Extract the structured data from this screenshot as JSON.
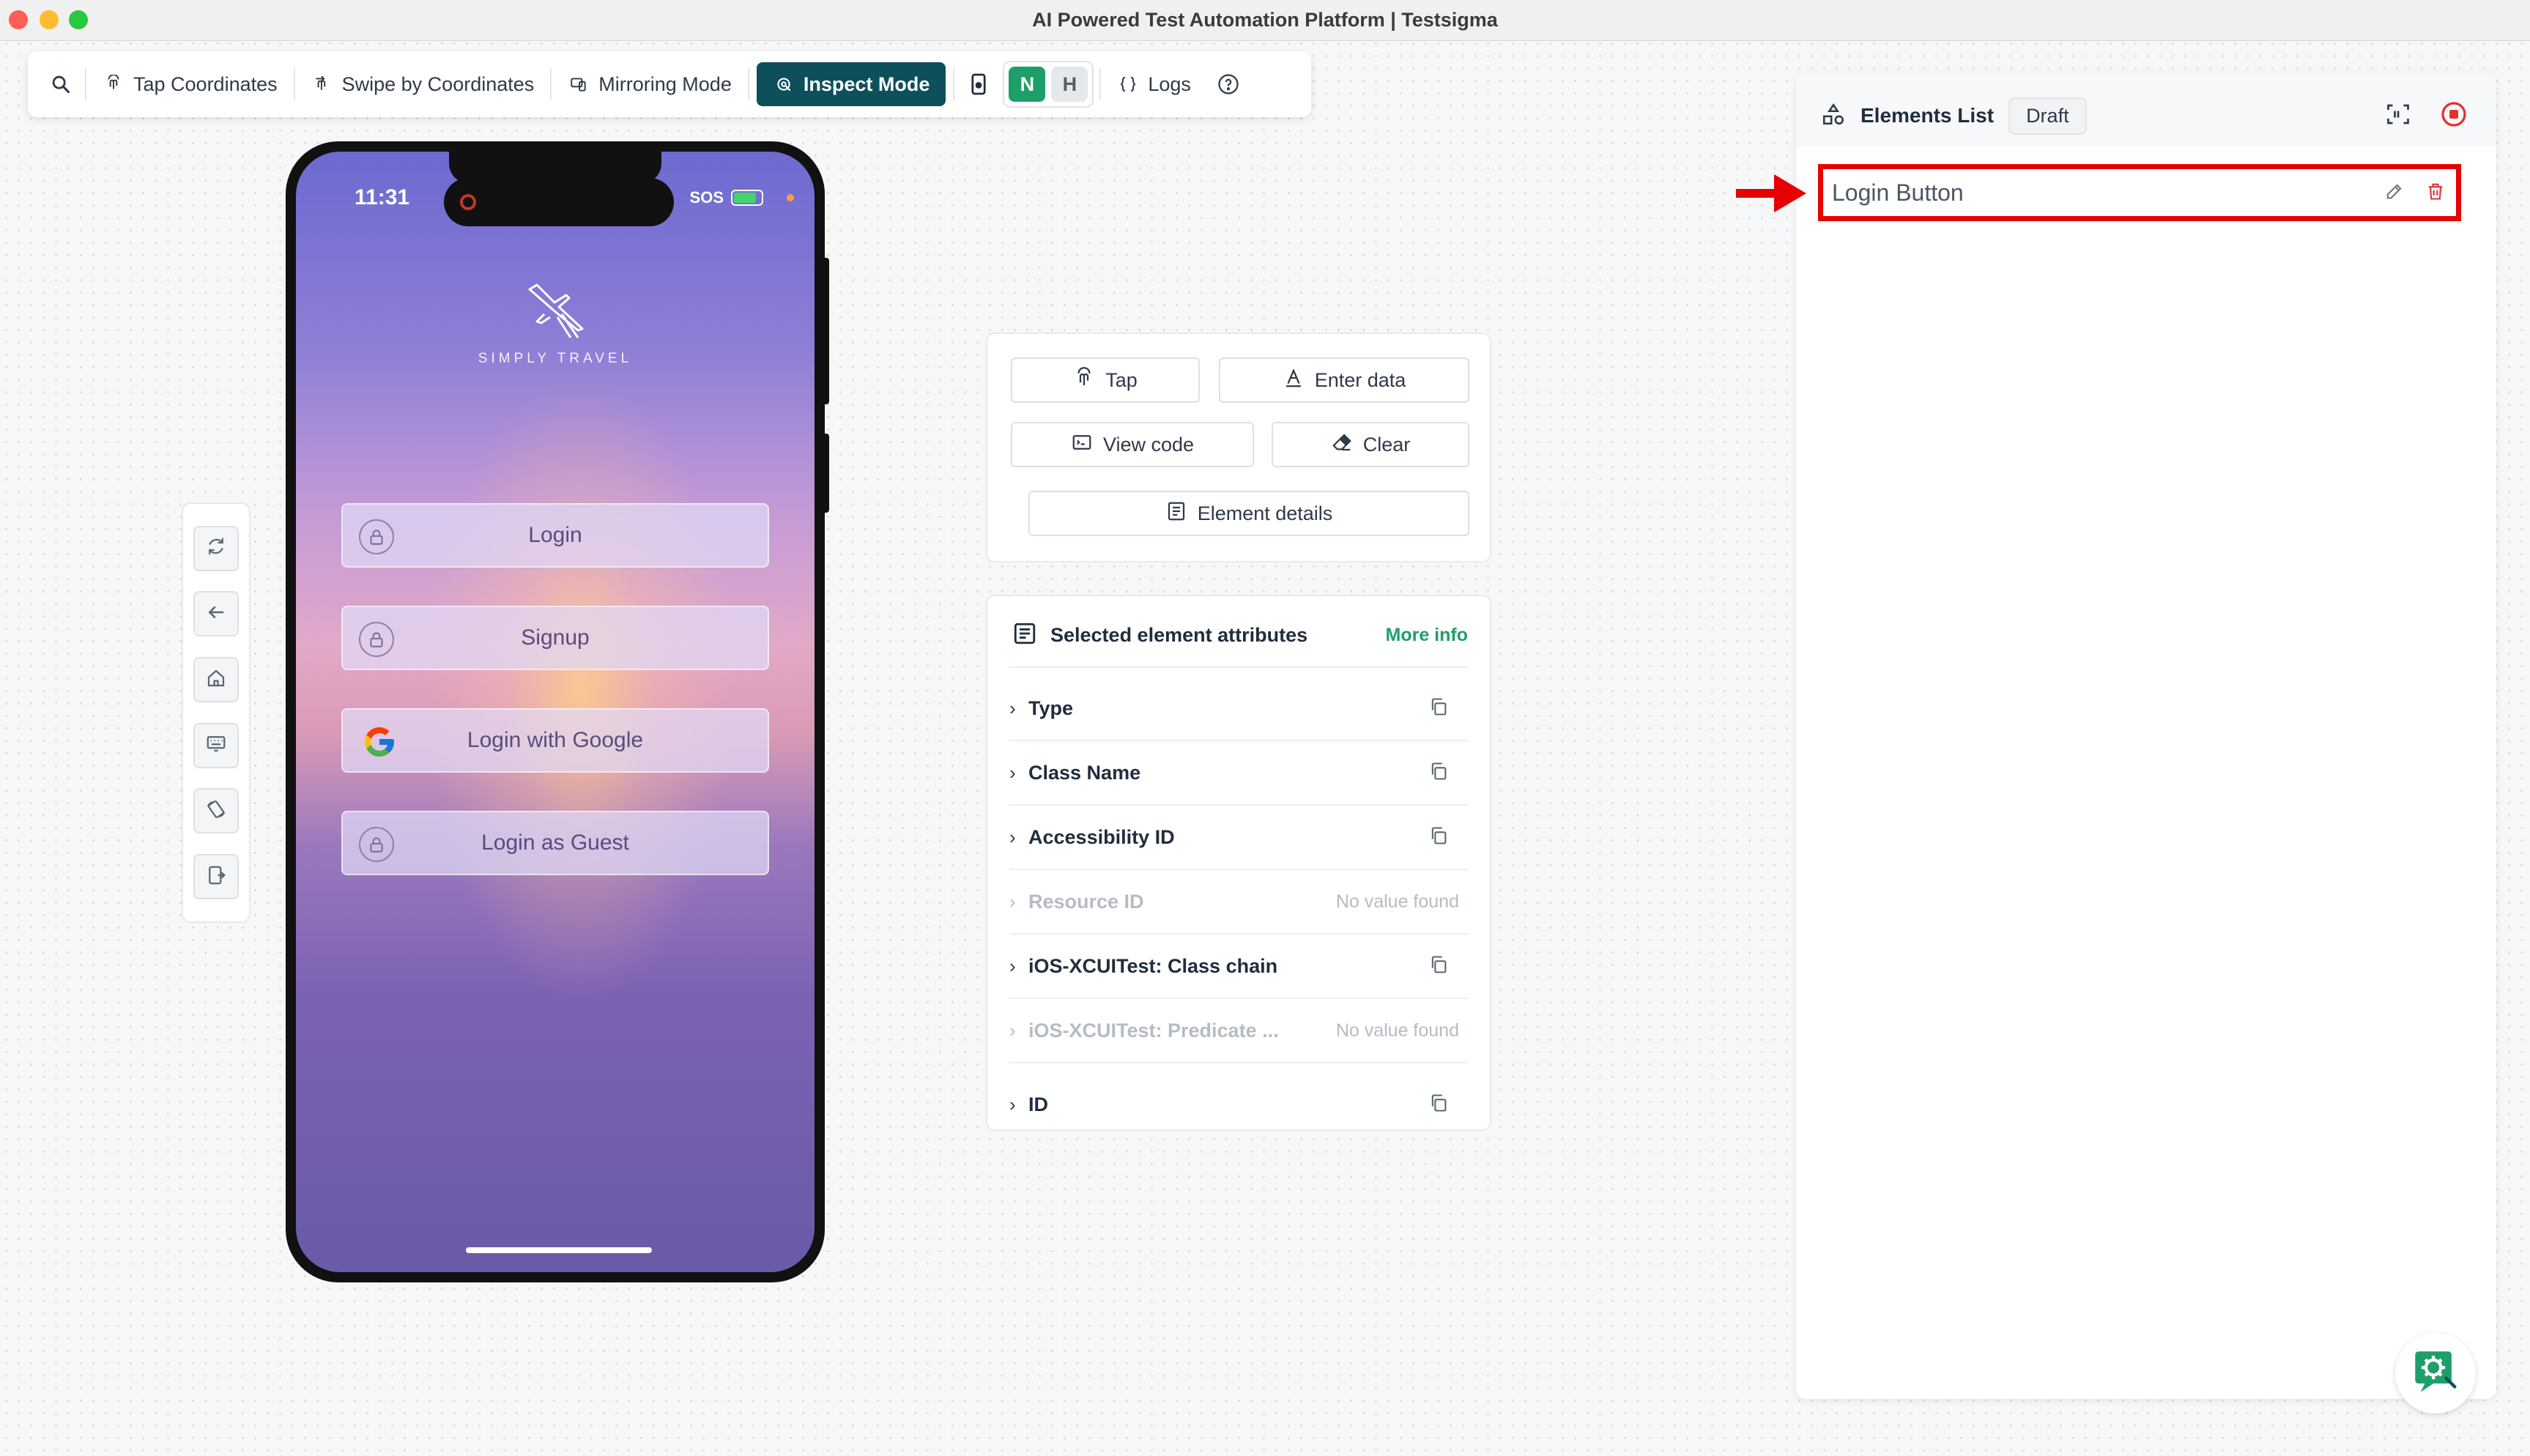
{
  "window": {
    "title": "AI Powered Test Automation Platform | Testsigma"
  },
  "toolbar": {
    "tap_coordinates": "Tap Coordinates",
    "swipe_by_coordinates": "Swipe by Coordinates",
    "mirroring_mode": "Mirroring Mode",
    "inspect_mode": "Inspect Mode",
    "n_label": "N",
    "h_label": "H",
    "logs": "Logs"
  },
  "phone": {
    "time": "11:31",
    "sos": "SOS",
    "logo_text": "SIMPLY TRAVEL",
    "buttons": [
      {
        "label": "Login"
      },
      {
        "label": "Signup"
      },
      {
        "label": "Login with Google"
      },
      {
        "label": "Login as Guest"
      }
    ]
  },
  "actions": {
    "tap": "Tap",
    "enter_data": "Enter data",
    "view_code": "View code",
    "clear": "Clear",
    "element_details": "Element details"
  },
  "attributes": {
    "title": "Selected element attributes",
    "more_info": "More info",
    "no_value": "No value found",
    "rows": [
      {
        "label": "Type"
      },
      {
        "label": "Class Name"
      },
      {
        "label": "Accessibility ID"
      },
      {
        "label": "Resource ID"
      },
      {
        "label": "iOS-XCUITest: Class chain"
      },
      {
        "label": "iOS-XCUITest: Predicate ..."
      },
      {
        "label": "ID"
      }
    ]
  },
  "elements_list": {
    "title": "Elements List",
    "draft": "Draft",
    "items": [
      {
        "label": "Login Button"
      }
    ]
  },
  "colors": {
    "accent_dark": "#0e4f5c",
    "accent_green": "#1d9f69",
    "highlight_red": "#e60000"
  }
}
